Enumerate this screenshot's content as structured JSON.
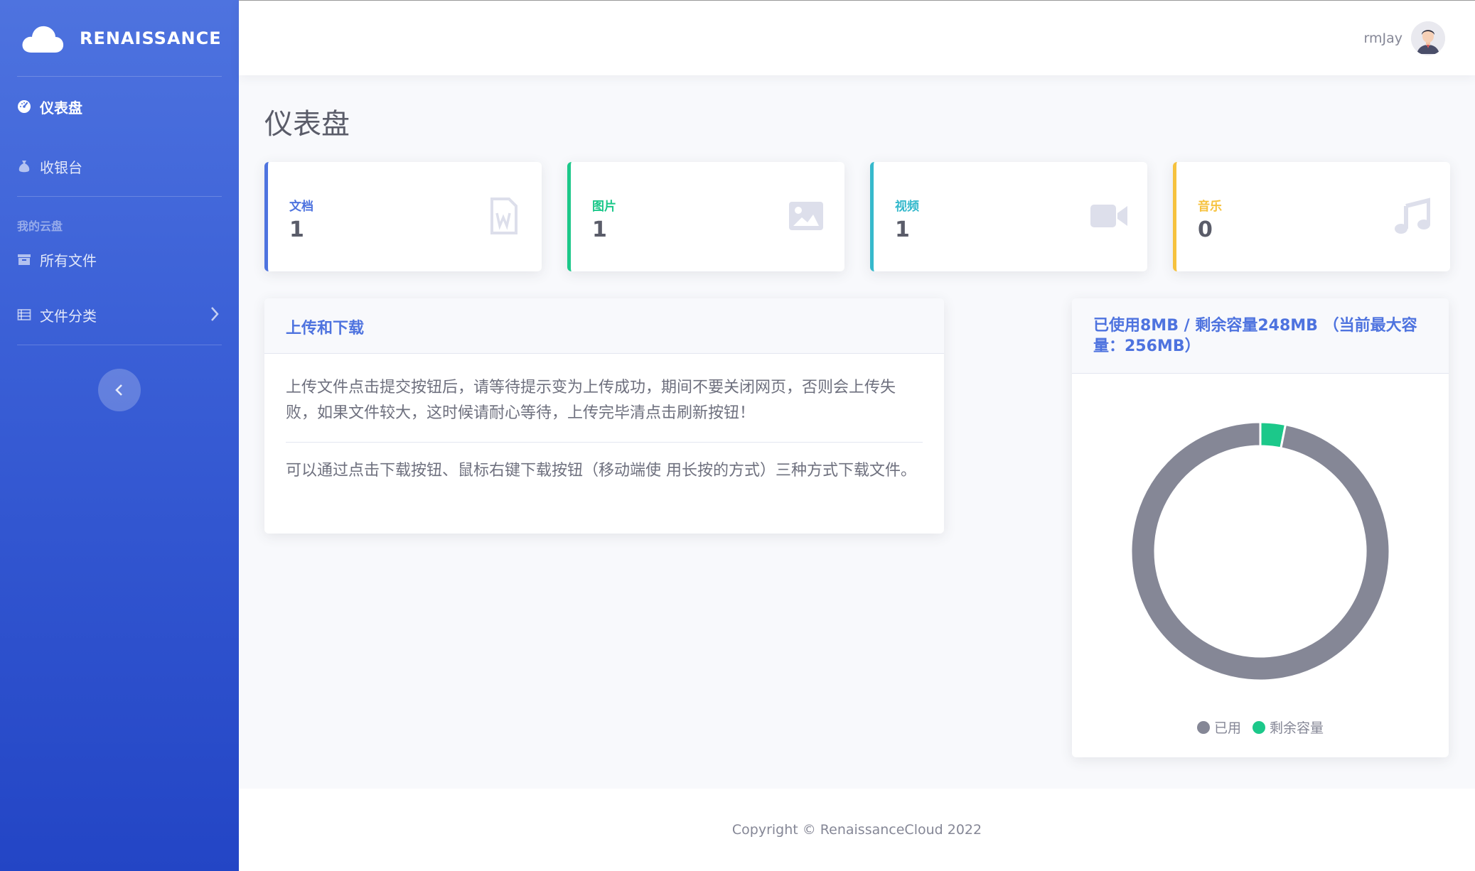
{
  "brand": {
    "name": "RENAISSANCE"
  },
  "sidebar": {
    "items": [
      {
        "label": "仪表盘",
        "icon": "dashboard-icon",
        "active": true
      },
      {
        "label": "收银台",
        "icon": "money-bag-icon"
      }
    ],
    "heading": "我的云盘",
    "files_items": [
      {
        "label": "所有文件",
        "icon": "archive-icon"
      },
      {
        "label": "文件分类",
        "icon": "table-list-icon"
      }
    ]
  },
  "topbar": {
    "username": "rmJay"
  },
  "page": {
    "title": "仪表盘"
  },
  "stats": [
    {
      "label": "文档",
      "value": "1",
      "color": "#4e73df",
      "icon": "file-word-icon"
    },
    {
      "label": "图片",
      "value": "1",
      "color": "#1cc88a",
      "icon": "image-icon"
    },
    {
      "label": "视频",
      "value": "1",
      "color": "#36b9cc",
      "icon": "video-icon"
    },
    {
      "label": "音乐",
      "value": "0",
      "color": "#f6c23e",
      "icon": "music-icon"
    }
  ],
  "upload_card": {
    "title": "上传和下载",
    "p1": "上传文件点击提交按钮后，请等待提示变为上传成功，期间不要关闭网页，否则会上传失败，如果文件较大，这时候请耐心等待，上传完毕清点击刷新按钮！",
    "p2": "可以通过点击下载按钮、鼠标右键下载按钮（移动端使 用长按的方式）三种方式下载文件。"
  },
  "storage_card": {
    "title": "已使用8MB / 剩余容量248MB （当前最大容量：256MB）"
  },
  "chart_data": {
    "type": "pie",
    "variant": "doughnut",
    "categories": [
      "已用",
      "剩余容量"
    ],
    "values": [
      248,
      8
    ],
    "colors": [
      "#858796",
      "#1cc88a"
    ]
  },
  "footer": {
    "text": "Copyright © RenaissanceCloud 2022"
  }
}
